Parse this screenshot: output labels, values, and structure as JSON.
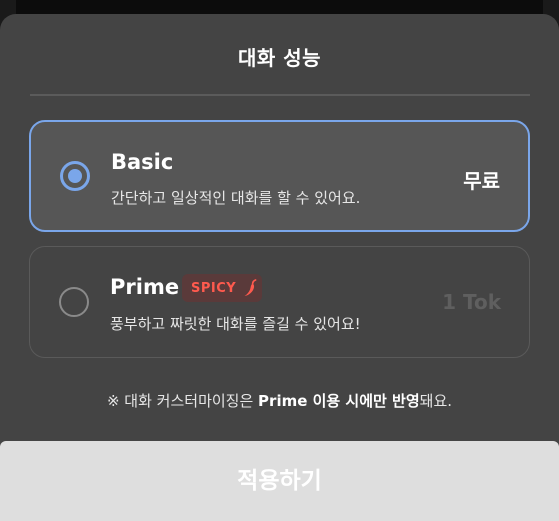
{
  "sheet": {
    "title": "대화 성능"
  },
  "options": [
    {
      "name": "Basic",
      "description": "간단하고 일상적인 대화를 할 수 있어요.",
      "price": "무료",
      "selected": true
    },
    {
      "name": "Prime",
      "badge": "SPICY",
      "badge_icon": "chili-pepper-icon",
      "description": "풍부하고 짜릿한 대화를 즐길 수 있어요!",
      "price": "1 Tok",
      "selected": false
    }
  ],
  "note": {
    "prefix": "※ 대화 커스터마이징은 ",
    "bold1": "Prime 이용 시에만 반영",
    "suffix": "돼요."
  },
  "apply_button": {
    "label": "적용하기"
  },
  "colors": {
    "accent": "#7aa6ea",
    "sheet_background": "#444444",
    "badge_text": "#ff5a4e",
    "badge_background": "#5a3a3a",
    "disabled_price": "#5f5f5f",
    "apply_button_background": "#dedede"
  }
}
